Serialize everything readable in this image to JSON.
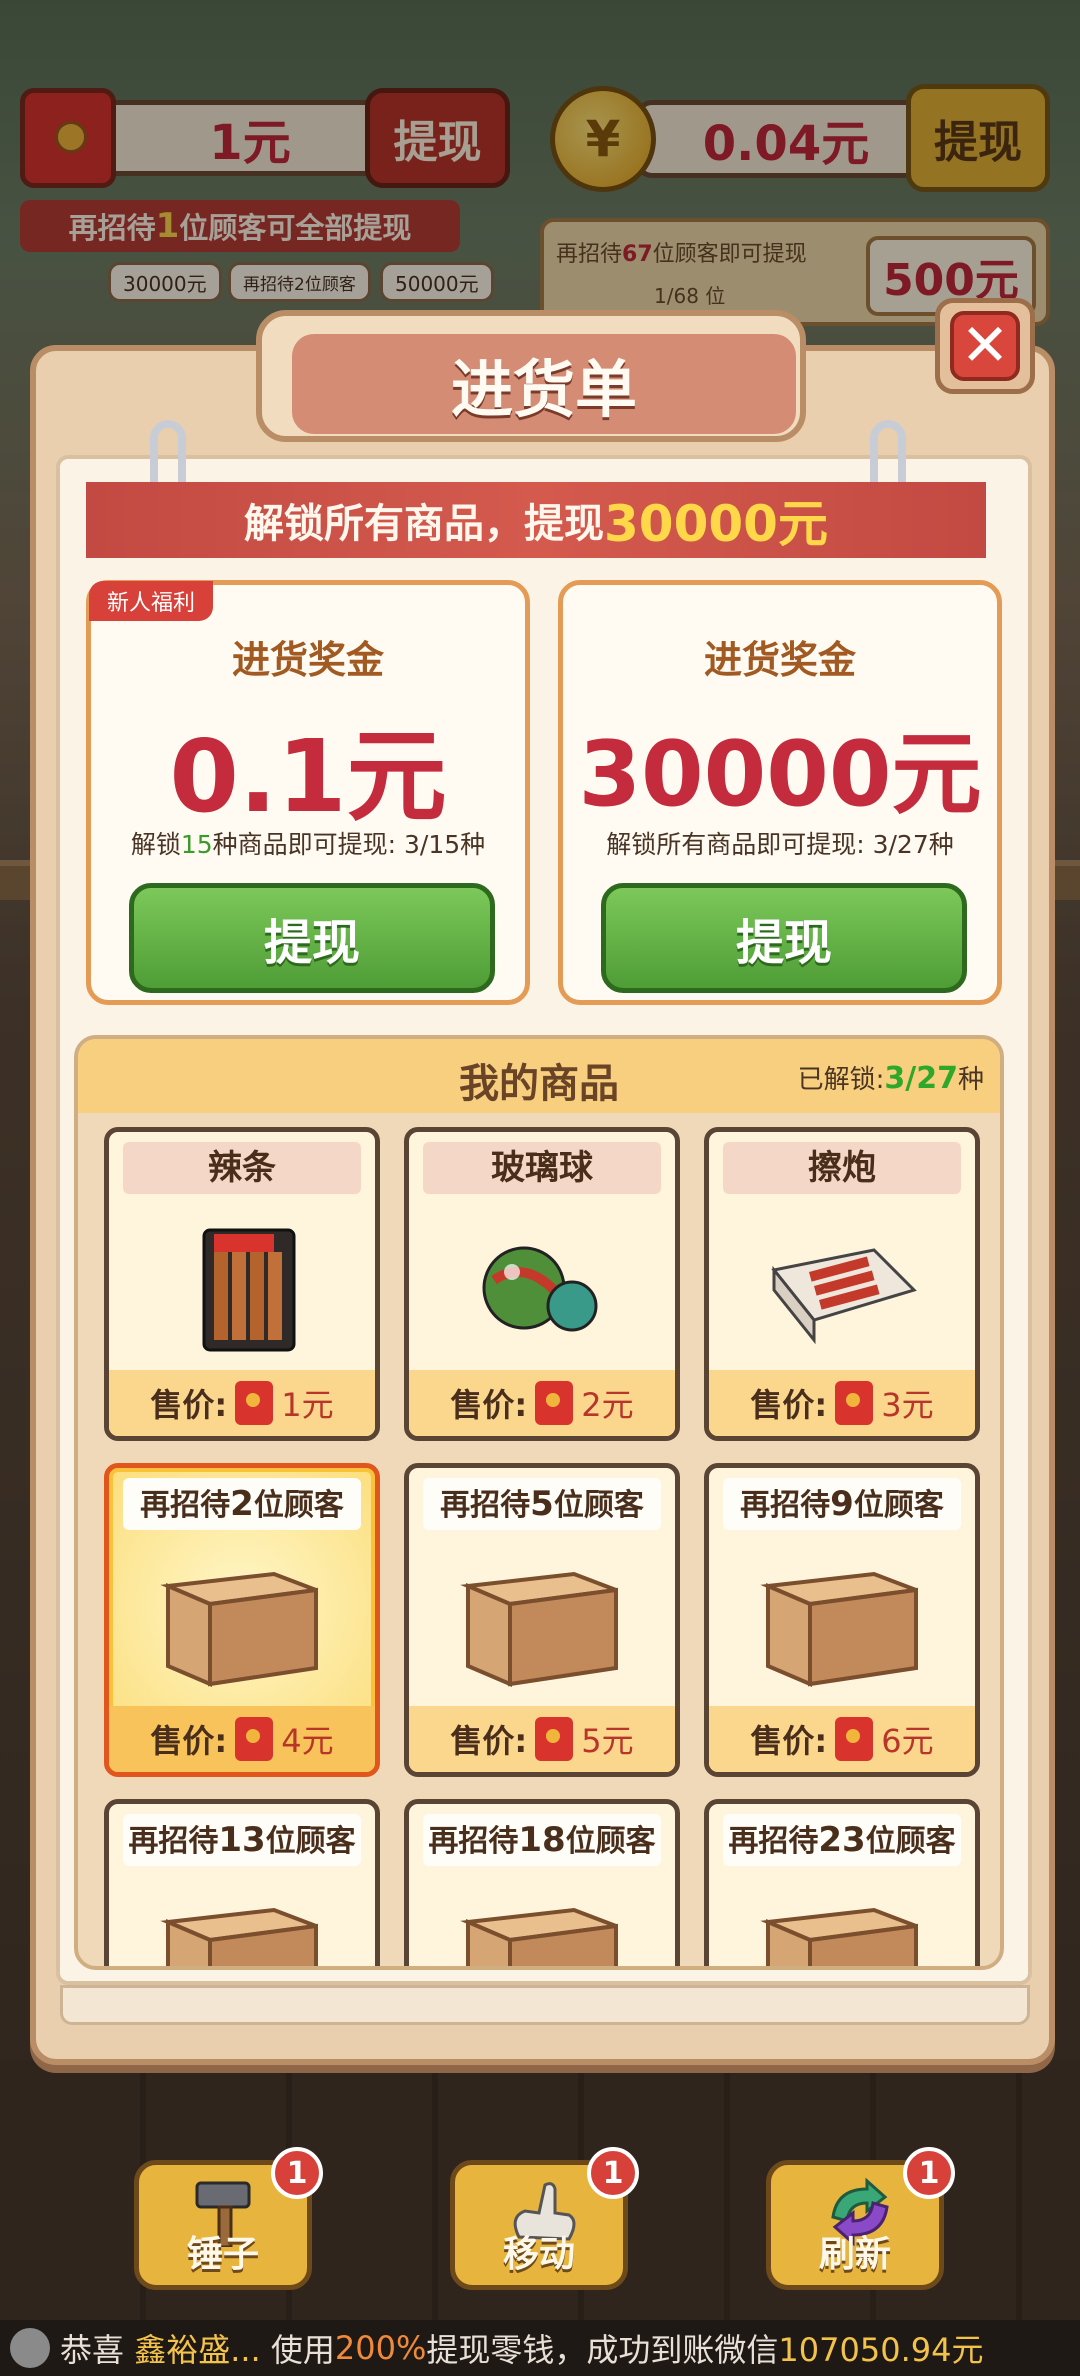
{
  "hud": {
    "cash_balance": "1元",
    "cash_withdraw_label": "提现",
    "hint_prefix": "再招待",
    "hint_number": "1",
    "hint_suffix": "位顾客可全部提现",
    "milestones": [
      "30000元",
      "再招待2位顾客",
      "50000元"
    ],
    "coin_symbol": "¥",
    "coin_balance": "0.04元",
    "coin_withdraw_label": "提现",
    "coin_hint_prefix": "再招待",
    "coin_hint_number": "67",
    "coin_hint_suffix": "位顾客即可提现",
    "coin_progress": "1/68 位",
    "coin_target": "500元"
  },
  "modal": {
    "title": "进货单",
    "close_symbol": "✕",
    "banner_text": "解锁所有商品，提现",
    "banner_amount": "30000元",
    "cards": [
      {
        "tag": "新人福利",
        "title": "进货奖金",
        "amount": "0.1元",
        "progress_prefix": "解锁",
        "progress_number": "15",
        "progress_suffix": "种商品即可提现: 3/15种",
        "button": "提现"
      },
      {
        "title": "进货奖金",
        "amount": "30000元",
        "progress_text": "解锁所有商品即可提现: 3/27种",
        "button": "提现"
      }
    ],
    "goods": {
      "title": "我的商品",
      "unlocked_label": "已解锁:",
      "unlocked_count": "3/27",
      "unlocked_unit": "种",
      "price_label": "售价:",
      "items": [
        {
          "name": "辣条",
          "price": "1元",
          "icon": "spicy-strip-icon"
        },
        {
          "name": "玻璃球",
          "price": "2元",
          "icon": "marbles-icon"
        },
        {
          "name": "擦炮",
          "price": "3元",
          "icon": "firecracker-icon"
        },
        {
          "lock_prefix": "再招待",
          "lock_number": "2",
          "lock_suffix": "位顾客",
          "price": "4元",
          "icon": "box-icon"
        },
        {
          "lock_prefix": "再招待",
          "lock_number": "5",
          "lock_suffix": "位顾客",
          "price": "5元",
          "icon": "box-icon"
        },
        {
          "lock_prefix": "再招待",
          "lock_number": "9",
          "lock_suffix": "位顾客",
          "price": "6元",
          "icon": "box-icon"
        },
        {
          "lock_prefix": "再招待",
          "lock_number": "13",
          "lock_suffix": "位顾客",
          "icon": "box-icon"
        },
        {
          "lock_prefix": "再招待",
          "lock_number": "18",
          "lock_suffix": "位顾客",
          "icon": "box-icon"
        },
        {
          "lock_prefix": "再招待",
          "lock_number": "23",
          "lock_suffix": "位顾客",
          "icon": "box-icon"
        }
      ]
    }
  },
  "toolbar": [
    {
      "label": "锤子",
      "badge": "1",
      "icon": "hammer-icon"
    },
    {
      "label": "移动",
      "badge": "1",
      "icon": "move-hand-icon"
    },
    {
      "label": "刷新",
      "badge": "1",
      "icon": "refresh-icon"
    }
  ],
  "ticker": {
    "prefix": "恭喜",
    "name": "鑫裕盛...",
    "middle": "使用",
    "percent": "200%",
    "suffix": "提现零钱，成功到账微信",
    "amount": "107050.94元"
  }
}
